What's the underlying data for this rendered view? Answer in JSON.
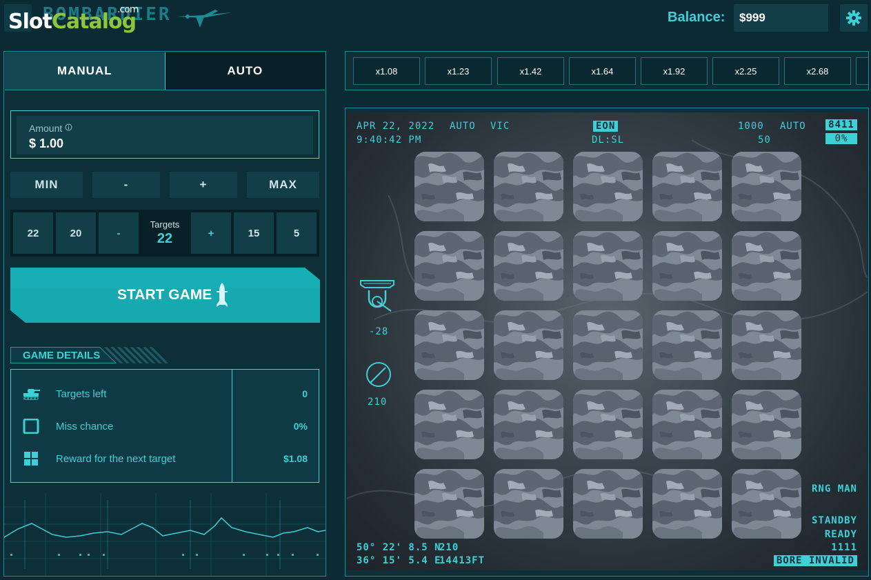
{
  "header": {
    "game_logo": "BOMBARDIER",
    "watermark": {
      "part1": "Slot",
      "part2": "Catalog",
      "part3": ".com"
    },
    "balance_label": "Balance:",
    "balance_value": "$999",
    "settings_icon": "gear-icon"
  },
  "tabs": [
    {
      "label": "MANUAL",
      "active": true
    },
    {
      "label": "AUTO",
      "active": false
    }
  ],
  "amount": {
    "label": "Amount",
    "info_icon": "info-icon",
    "value": "$ 1.00"
  },
  "bet_buttons": [
    "MIN",
    "-",
    "+",
    "MAX"
  ],
  "targets": {
    "label": "Targets",
    "value": "22",
    "options_left": [
      "22",
      "20"
    ],
    "minus": "-",
    "plus": "+",
    "options_right": [
      "15",
      "5"
    ]
  },
  "start_button": {
    "label": "START GAME",
    "icon": "missile-icon"
  },
  "game_details": {
    "title": "GAME DETAILS",
    "rows": [
      {
        "icon": "tank-icon",
        "label": "Targets left",
        "value": "0"
      },
      {
        "icon": "square-icon",
        "label": "Miss chance",
        "value": "0%"
      },
      {
        "icon": "grid-icon",
        "label": "Reward for the next target",
        "value": "$1.08"
      }
    ]
  },
  "multipliers": [
    "x1.08",
    "x1.23",
    "x1.42",
    "x1.64",
    "x1.92",
    "x2.25",
    "x2.68"
  ],
  "hud": {
    "date": "APR 22, 2022",
    "time": "9:40:42 PM",
    "mode1": "AUTO",
    "mode2": "VIC",
    "eon": "EON",
    "dl": "DL:SL",
    "alt1": "1000",
    "alt2": "50",
    "mode3": "AUTO",
    "code": "8411",
    "pct": "0%",
    "gimbal_value": "-28",
    "heading_value": "210",
    "rng": "RNG MAN",
    "standby": "STANDBY",
    "ready": "READY",
    "num": "1111",
    "bore": "BORE INVALID",
    "lat": "50° 22' 8.5 N",
    "lon": "36° 15' 5.4 E",
    "heading2": "210",
    "altitude": "14413FT"
  },
  "grid": {
    "rows": 5,
    "cols": 5
  },
  "colors": {
    "accent": "#3ed0d6",
    "panel": "#0c2f38",
    "button": "#123e48",
    "start": "#17a9b0"
  }
}
